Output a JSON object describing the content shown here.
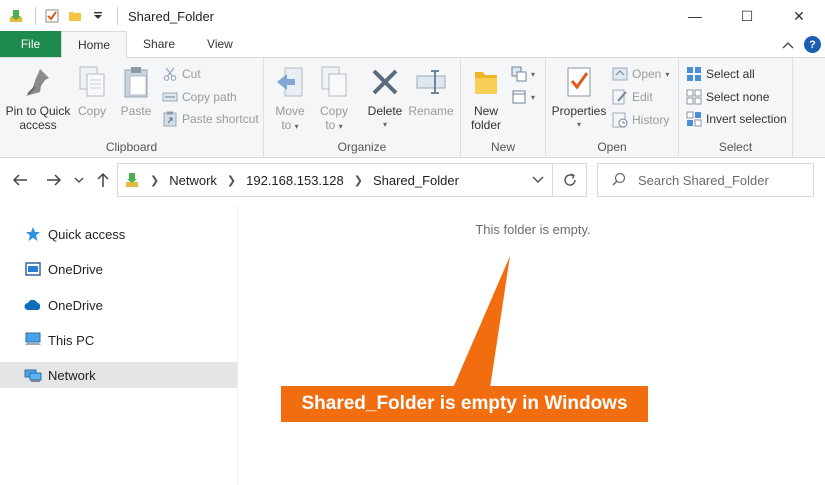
{
  "window": {
    "title": "Shared_Folder",
    "minimize_glyph": "—",
    "maximize_glyph": "☐",
    "close_glyph": "✕"
  },
  "ribbon_tabs": [
    {
      "label": "File"
    },
    {
      "label": "Home"
    },
    {
      "label": "Share"
    },
    {
      "label": "View"
    }
  ],
  "ribbon": {
    "clipboard": {
      "label": "Clipboard",
      "pin_line1": "Pin to Quick",
      "pin_line2": "access",
      "copy": "Copy",
      "paste": "Paste",
      "cut": "Cut",
      "copy_path": "Copy path",
      "paste_shortcut": "Paste shortcut"
    },
    "organize": {
      "label": "Organize",
      "move_line1": "Move",
      "move_line2": "to",
      "copy_line1": "Copy",
      "copy_line2": "to",
      "delete": "Delete",
      "rename": "Rename"
    },
    "new": {
      "label": "New",
      "new_folder_line1": "New",
      "new_folder_line2": "folder"
    },
    "open": {
      "label": "Open",
      "properties": "Properties",
      "open": "Open",
      "edit": "Edit",
      "history": "History"
    },
    "select": {
      "label": "Select",
      "select_all": "Select all",
      "select_none": "Select none",
      "invert": "Invert selection"
    }
  },
  "address": {
    "crumbs": [
      "Network",
      "192.168.153.128",
      "Shared_Folder"
    ]
  },
  "search": {
    "placeholder": "Search Shared_Folder"
  },
  "nav_pane": [
    {
      "label": "Quick access",
      "icon": "star-icon"
    },
    {
      "label": "OneDrive",
      "icon": "onedrive-business-icon"
    },
    {
      "label": "OneDrive",
      "icon": "onedrive-cloud-icon"
    },
    {
      "label": "This PC",
      "icon": "computer-icon"
    },
    {
      "label": "Network",
      "icon": "network-icon",
      "selected": true
    }
  ],
  "content": {
    "empty_message": "This folder is empty."
  },
  "annotation": {
    "callout_text": "Shared_Folder is empty in Windows"
  },
  "colors": {
    "callout": "#f26d0f",
    "file_tab": "#1e8a4d",
    "accent_blue": "#1a5fb4",
    "selected_nav": "#e5e5e5"
  }
}
